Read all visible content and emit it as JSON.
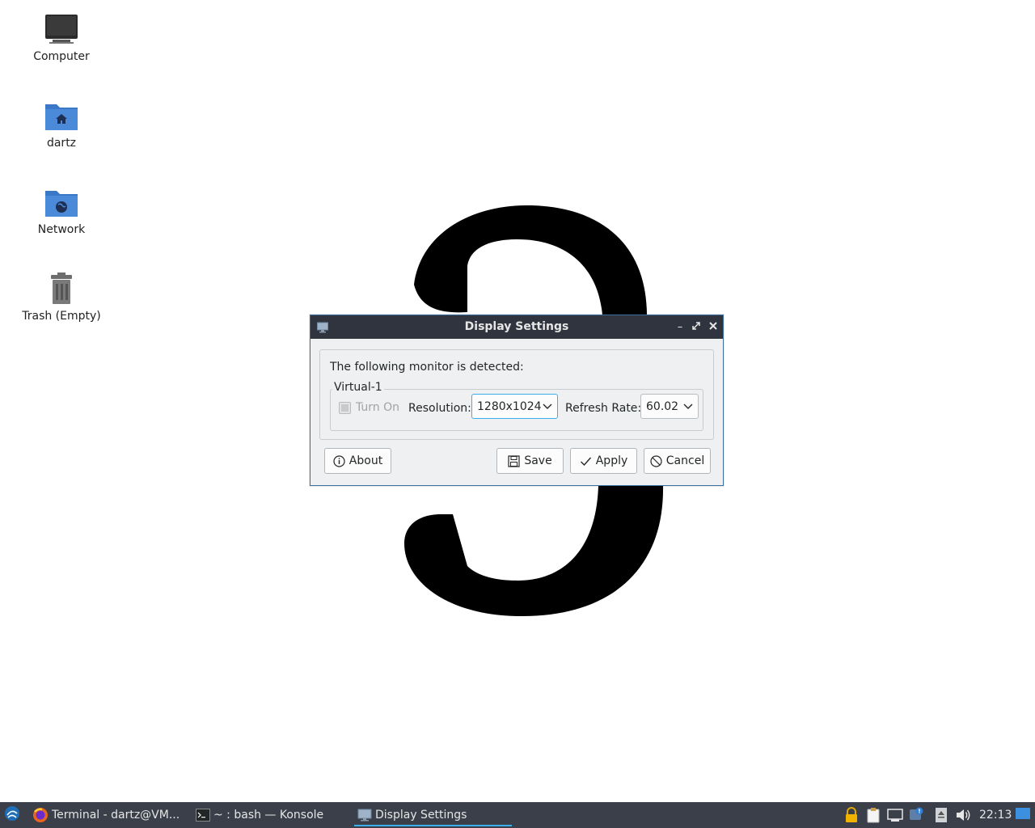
{
  "desktop": {
    "icons": [
      {
        "label": "Computer",
        "icon": "computer-icon"
      },
      {
        "label": "dartz",
        "icon": "home-folder-icon"
      },
      {
        "label": "Network",
        "icon": "network-folder-icon"
      },
      {
        "label": "Trash (Empty)",
        "icon": "trash-icon"
      }
    ]
  },
  "dialog": {
    "title": "Display Settings",
    "detected_text": "The following monitor is detected:",
    "monitor": {
      "name": "Virtual-1",
      "turn_on_label": "Turn On",
      "turn_on_checked": true,
      "turn_on_enabled": false,
      "resolution_label": "Resolution:",
      "resolution_value": "1280x1024",
      "refresh_label": "Refresh Rate:",
      "refresh_value": "60.02"
    },
    "buttons": {
      "about": "About",
      "save": "Save",
      "apply": "Apply",
      "cancel": "Cancel"
    }
  },
  "taskbar": {
    "tasks": [
      {
        "label": "Terminal - dartz@VM...",
        "icon": "firefox-icon"
      },
      {
        "label": "~ : bash — Konsole",
        "icon": "terminal-icon"
      },
      {
        "label": "Display Settings",
        "icon": "monitor-icon",
        "active": true
      }
    ],
    "clock": "22:13"
  },
  "colors": {
    "titlebar": "#2f343f",
    "taskbar": "#3a3f4a",
    "accent": "#3daee9",
    "folder": "#4a86d4"
  }
}
